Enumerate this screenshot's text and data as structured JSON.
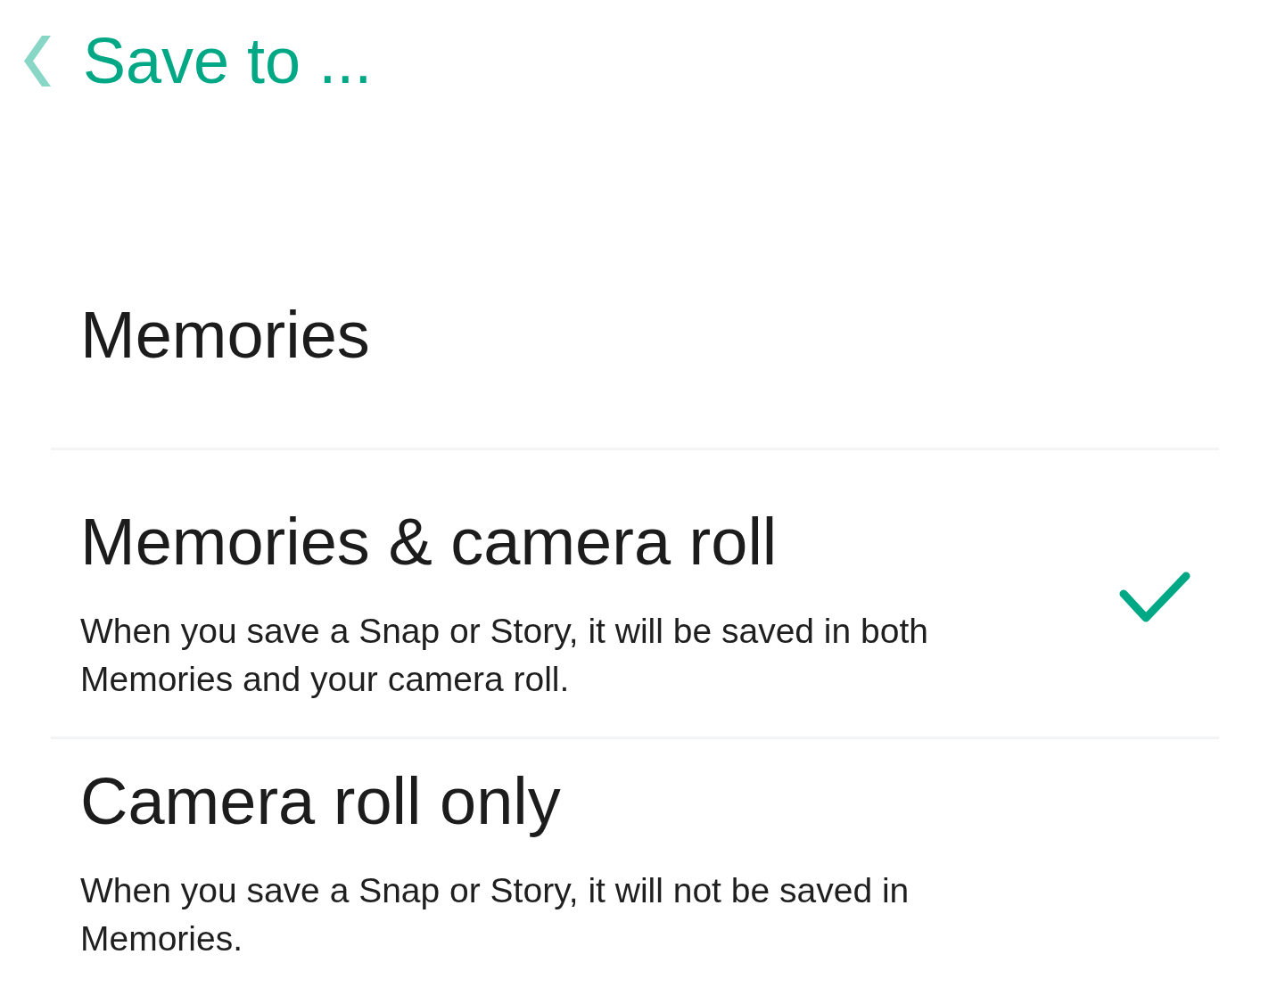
{
  "header": {
    "title": "Save to ..."
  },
  "options": [
    {
      "title": "Memories",
      "selected": false
    },
    {
      "title": "Memories & camera roll",
      "description": "When you save a Snap or Story, it will be saved in both Memories and your camera roll.",
      "selected": true
    },
    {
      "title": "Camera roll only",
      "description": "When you save a Snap or Story, it will not be saved in Memories.",
      "selected": false
    }
  ]
}
